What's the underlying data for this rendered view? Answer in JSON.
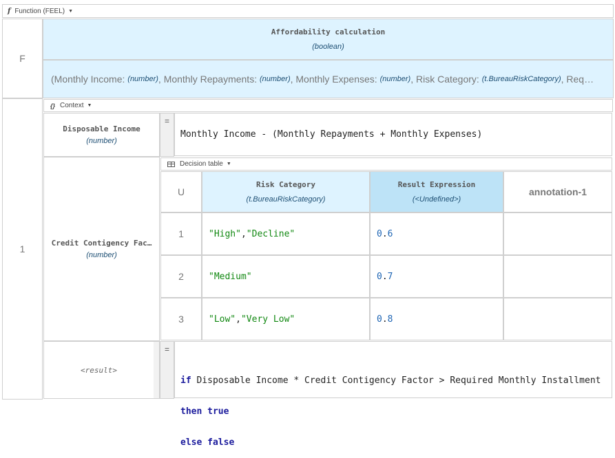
{
  "function_header": {
    "icon_glyph": "f",
    "label": "Function (FEEL)"
  },
  "function": {
    "row_label": "F",
    "name": "Affordability calculation",
    "type": "(boolean)",
    "params": [
      {
        "name": "Monthly Income",
        "type": "(number)"
      },
      {
        "name": "Monthly Repayments",
        "type": "(number)"
      },
      {
        "name": "Monthly Expenses",
        "type": "(number)"
      },
      {
        "name": "Risk Category",
        "type": "(t.BureauRiskCategory)"
      }
    ],
    "params_overflow": "Req…"
  },
  "context": {
    "row_label": "1",
    "icon_glyph": "{}",
    "label": "Context",
    "entries": [
      {
        "name": "Disposable Income",
        "type": "(number)",
        "expression": "Monthly Income - (Monthly Repayments + Monthly Expenses)"
      },
      {
        "name": "Credit Contigency Fac…",
        "type": "(number)"
      }
    ],
    "result_label": "<result>",
    "result_lines": {
      "l1_kw": "if",
      "l1_rest": " Disposable Income * Credit Contigency Factor > Required Monthly Installment",
      "l2_kw1": "then",
      "l2_kw2": "true",
      "l3_kw1": "else",
      "l3_kw2": "false"
    }
  },
  "decision_table": {
    "label": "Decision table",
    "hit_policy": "U",
    "columns": [
      {
        "name": "Risk Category",
        "type": "(t.BureauRiskCategory)"
      },
      {
        "name": "Result Expression",
        "type": "(<Undefined>)"
      },
      {
        "name": "annotation-1"
      }
    ],
    "rows": [
      {
        "num": "1",
        "in_a": "\"High\"",
        "in_sep": ", ",
        "in_b": "\"Decline\"",
        "out_int": "0",
        "out_dot": ".",
        "out_frac": "6"
      },
      {
        "num": "2",
        "in_a": "\"Medium\"",
        "in_sep": "",
        "in_b": "",
        "out_int": "0",
        "out_dot": ".",
        "out_frac": "7"
      },
      {
        "num": "3",
        "in_a": "\"Low\"",
        "in_sep": ", ",
        "in_b": "\"Very Low\"",
        "out_int": "0",
        "out_dot": ".",
        "out_frac": "8"
      }
    ]
  },
  "colors": {
    "header_blue": "#def3ff",
    "output_blue": "#bde3f7",
    "keyword": "#1a1a9c",
    "string": "#118811",
    "number": "#1e65b4"
  }
}
